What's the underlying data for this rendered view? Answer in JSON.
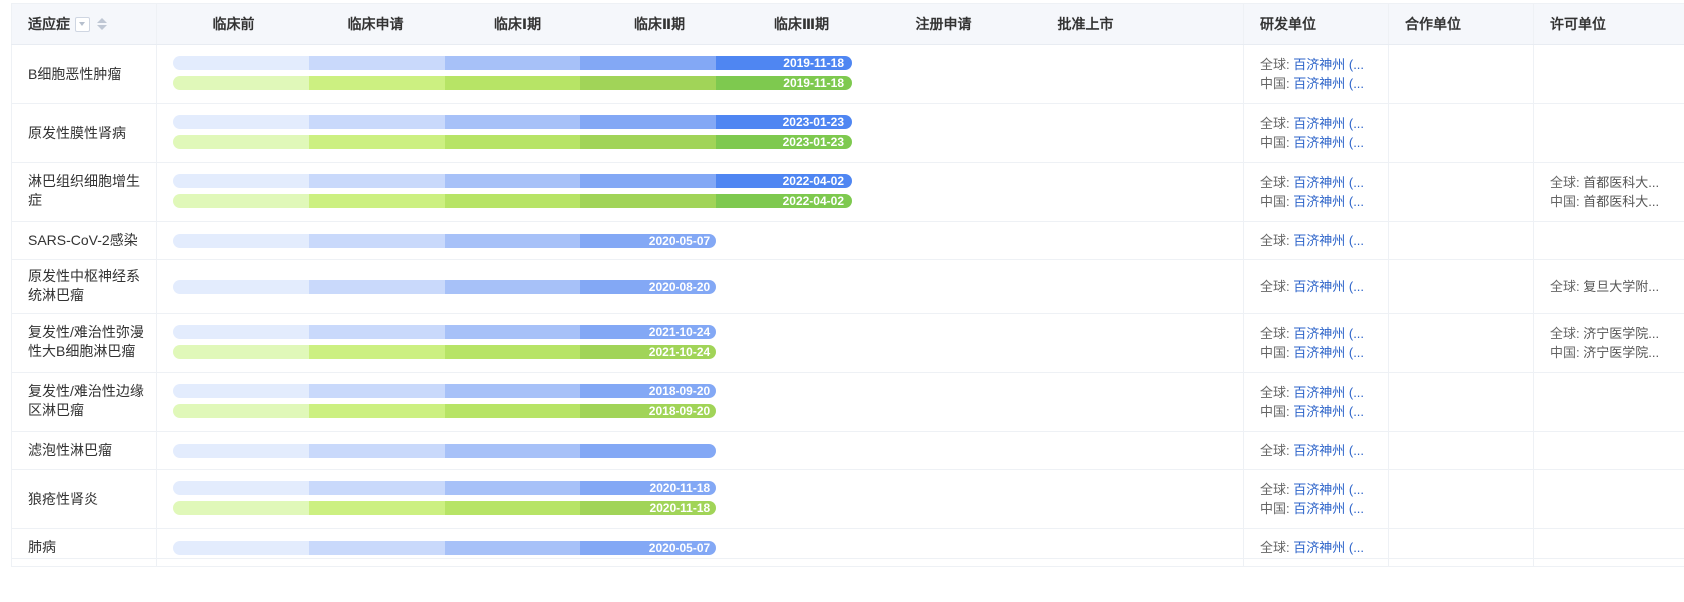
{
  "header": {
    "indication": "适应症",
    "phases": [
      "临床前",
      "临床申请",
      "临床Ⅰ期",
      "临床Ⅱ期",
      "临床Ⅲ期",
      "注册申请",
      "批准上市"
    ],
    "developer": "研发单位",
    "partner": "合作单位",
    "licensor": "许可单位"
  },
  "labels": {
    "global": "全球:",
    "china": "中国:"
  },
  "rows": [
    {
      "indication": "B细胞恶性肿瘤",
      "blue": {
        "stages": 5,
        "date": "2019-11-18"
      },
      "green": {
        "stages": 5,
        "date": "2019-11-18"
      },
      "dev": [
        {
          "r": "全球:",
          "n": "百济神州 (..."
        },
        {
          "r": "中国:",
          "n": "百济神州 (..."
        }
      ],
      "lic": []
    },
    {
      "indication": "原发性膜性肾病",
      "blue": {
        "stages": 5,
        "date": "2023-01-23"
      },
      "green": {
        "stages": 5,
        "date": "2023-01-23"
      },
      "dev": [
        {
          "r": "全球:",
          "n": "百济神州 (..."
        },
        {
          "r": "中国:",
          "n": "百济神州 (..."
        }
      ],
      "lic": []
    },
    {
      "indication": "淋巴组织细胞增生症",
      "blue": {
        "stages": 5,
        "date": "2022-04-02"
      },
      "green": {
        "stages": 5,
        "date": "2022-04-02"
      },
      "dev": [
        {
          "r": "全球:",
          "n": "百济神州 (..."
        },
        {
          "r": "中国:",
          "n": "百济神州 (..."
        }
      ],
      "lic": [
        {
          "r": "全球:",
          "n": "首都医科大..."
        },
        {
          "r": "中国:",
          "n": "首都医科大..."
        }
      ]
    },
    {
      "indication": "SARS-CoV-2感染",
      "blue": {
        "stages": 4,
        "date": "2020-05-07"
      },
      "green": null,
      "dev": [
        {
          "r": "全球:",
          "n": "百济神州 (..."
        }
      ],
      "lic": []
    },
    {
      "indication": "原发性中枢神经系统淋巴瘤",
      "blue": {
        "stages": 4,
        "date": "2020-08-20"
      },
      "green": null,
      "dev": [
        {
          "r": "全球:",
          "n": "百济神州 (..."
        }
      ],
      "lic": [
        {
          "r": "全球:",
          "n": "复旦大学附..."
        }
      ]
    },
    {
      "indication": "复发性/难治性弥漫性大B细胞淋巴瘤",
      "blue": {
        "stages": 4,
        "date": "2021-10-24"
      },
      "green": {
        "stages": 4,
        "date": "2021-10-24"
      },
      "dev": [
        {
          "r": "全球:",
          "n": "百济神州 (..."
        },
        {
          "r": "中国:",
          "n": "百济神州 (..."
        }
      ],
      "lic": [
        {
          "r": "全球:",
          "n": "济宁医学院..."
        },
        {
          "r": "中国:",
          "n": "济宁医学院..."
        }
      ]
    },
    {
      "indication": "复发性/难治性边缘区淋巴瘤",
      "blue": {
        "stages": 4,
        "date": "2018-09-20"
      },
      "green": {
        "stages": 4,
        "date": "2018-09-20"
      },
      "dev": [
        {
          "r": "全球:",
          "n": "百济神州 (..."
        },
        {
          "r": "中国:",
          "n": "百济神州 (..."
        }
      ],
      "lic": []
    },
    {
      "indication": "滤泡性淋巴瘤",
      "blue": {
        "stages": 4,
        "date": ""
      },
      "green": null,
      "dev": [
        {
          "r": "全球:",
          "n": "百济神州 (..."
        }
      ],
      "lic": []
    },
    {
      "indication": "狼疮性肾炎",
      "blue": {
        "stages": 4,
        "date": "2020-11-18"
      },
      "green": {
        "stages": 4,
        "date": "2020-11-18"
      },
      "dev": [
        {
          "r": "全球:",
          "n": "百济神州 (..."
        },
        {
          "r": "中国:",
          "n": "百济神州 (..."
        }
      ],
      "lic": []
    },
    {
      "indication": "肺病",
      "blue": {
        "stages": 4,
        "date": "2020-05-07"
      },
      "green": null,
      "dev": [
        {
          "r": "全球:",
          "n": "百济神州 (..."
        }
      ],
      "lic": []
    }
  ]
}
